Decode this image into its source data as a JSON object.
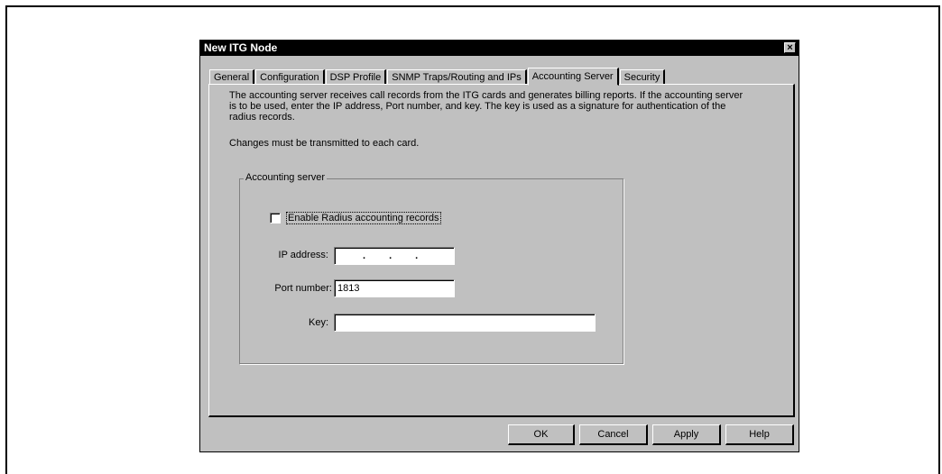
{
  "dialog": {
    "title": "New ITG Node",
    "close_label": "×"
  },
  "tabs": [
    {
      "label": "General"
    },
    {
      "label": "Configuration"
    },
    {
      "label": "DSP Profile"
    },
    {
      "label": "SNMP Traps/Routing and IPs"
    },
    {
      "label": "Accounting Server"
    },
    {
      "label": "Security"
    }
  ],
  "active_tab": "Accounting Server",
  "content": {
    "description": "The accounting server receives call records from the ITG cards and generates billing reports. If the accounting server is to be used, enter the IP address, Port number, and key. The key is used as a signature for authentication of the radius records.",
    "note": "Changes must be transmitted to each card."
  },
  "group": {
    "label": "Accounting server",
    "checkbox_label": "Enable Radius accounting records",
    "checkbox_checked": false,
    "ip_label": "IP address:",
    "ip_value": "",
    "port_label": "Port number:",
    "port_value": "1813",
    "key_label": "Key:",
    "key_value": ""
  },
  "buttons": {
    "ok": "OK",
    "cancel": "Cancel",
    "apply": "Apply",
    "help": "Help"
  }
}
